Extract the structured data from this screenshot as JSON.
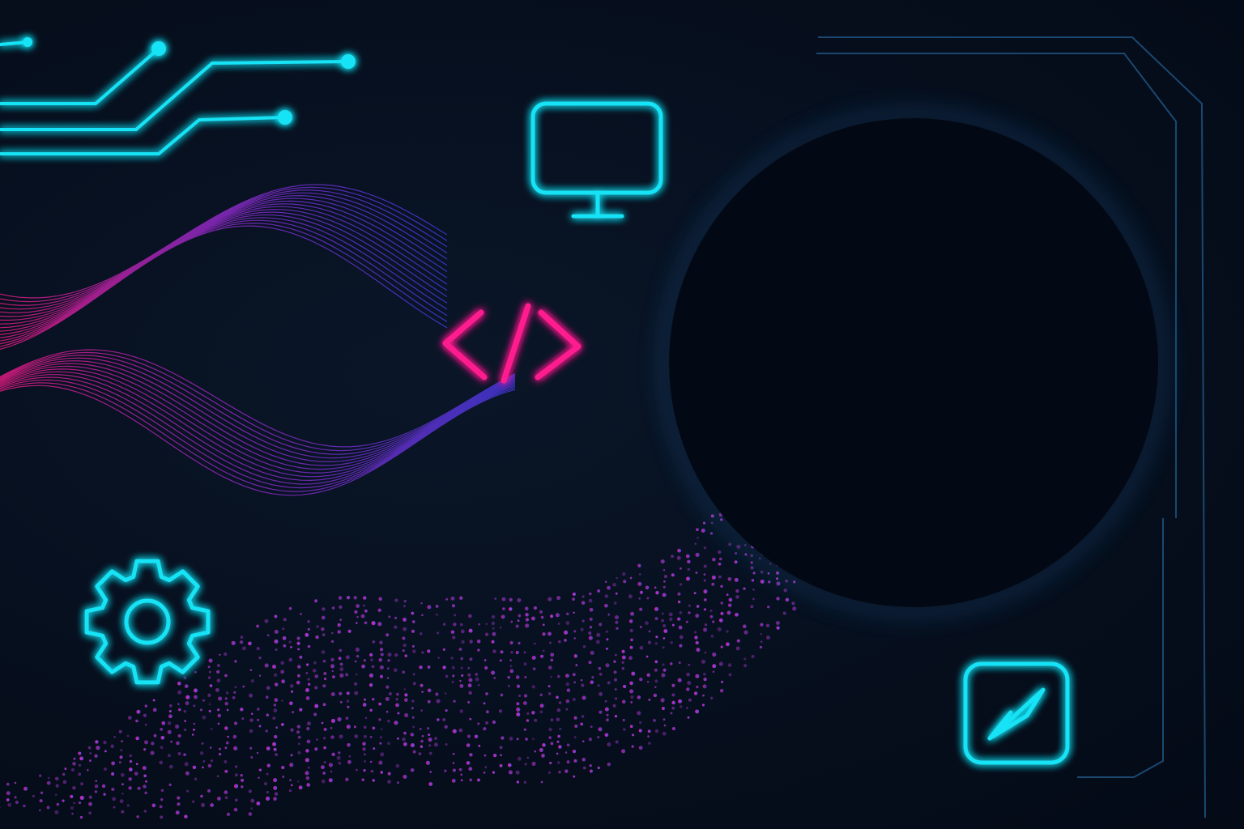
{
  "colors": {
    "background": "#050d1b",
    "cyan": "#19e3f5",
    "magenta": "#ff1c8e",
    "violet": "#5b3cf0",
    "purple": "#a52bd6",
    "circle_fill": "#030914",
    "frame": "#1d4f7a"
  },
  "icons": {
    "monitor": "monitor-icon",
    "code": "code-brackets-icon",
    "gear": "gear-icon",
    "pen": "pen-icon"
  }
}
